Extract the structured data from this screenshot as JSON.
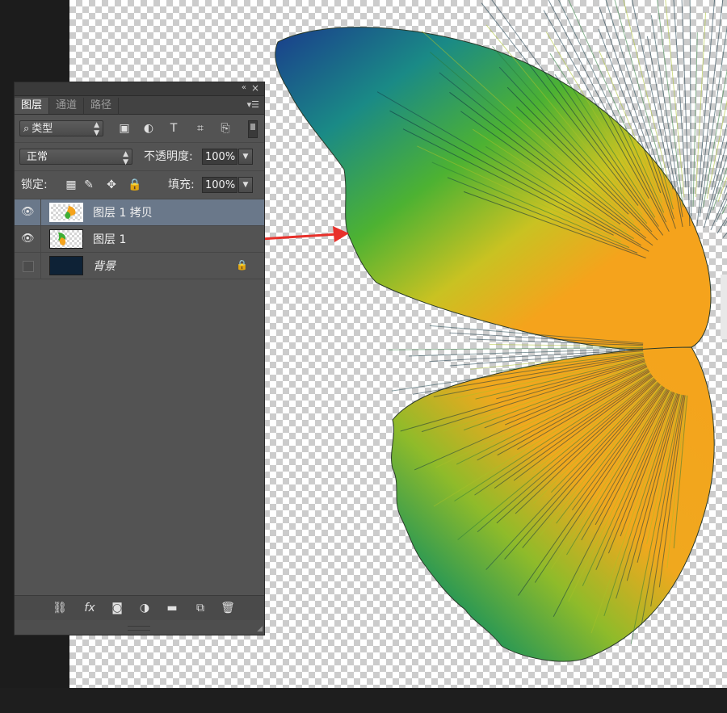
{
  "panel": {
    "tabs": [
      {
        "label": "图层",
        "active": true
      },
      {
        "label": "通道",
        "active": false
      },
      {
        "label": "路径",
        "active": false
      }
    ],
    "titlebar": {
      "collapse_icon": "«",
      "close_icon": "×"
    },
    "filter": {
      "search_icon": "⌕",
      "kind_label": "类型"
    },
    "blend_mode": "正常",
    "opacity": {
      "label": "不透明度:",
      "value": "100%"
    },
    "lock": {
      "label": "锁定:"
    },
    "fill": {
      "label": "填充:",
      "value": "100%"
    },
    "layers": [
      {
        "name": "图层 1 拷贝",
        "visible": true,
        "selected": true
      },
      {
        "name": "图层 1",
        "visible": true,
        "selected": false
      },
      {
        "name": "背景",
        "visible": false,
        "selected": false,
        "locked": true
      }
    ]
  },
  "colors": {
    "wing_orange": "#f5a31c",
    "wing_green": "#3fae36",
    "wing_blue": "#1f3f8f",
    "arrow": "#e8302a",
    "selected_layer": "#6a788a"
  }
}
